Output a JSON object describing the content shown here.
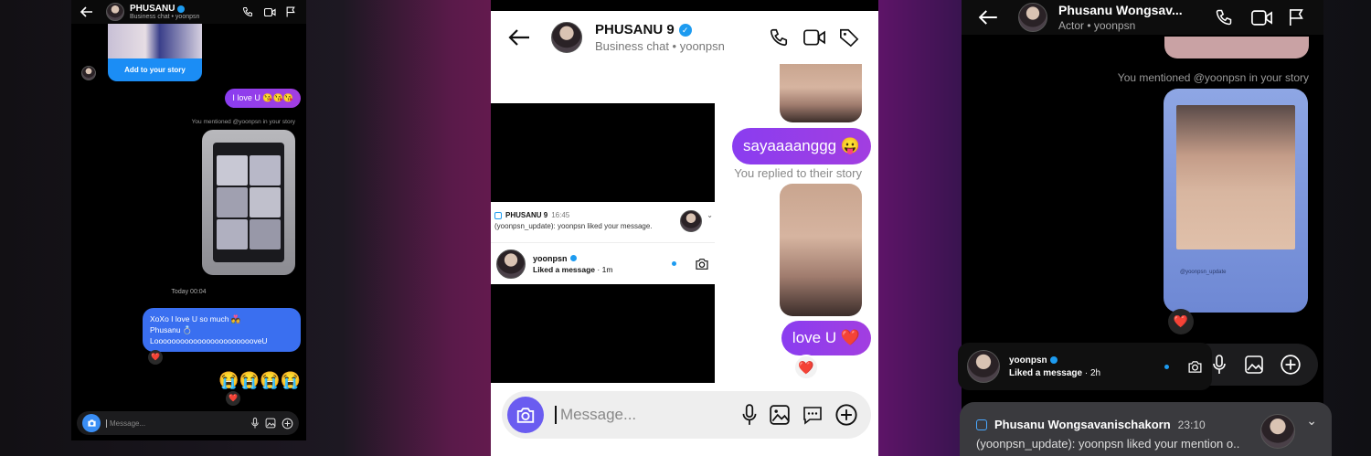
{
  "left": {
    "contact_name": "PHUSANU",
    "contact_sub": "Business chat • yoonpsn",
    "add_story": "Add to your story",
    "msg_love": "I love U 😘😘😘",
    "mention_note": "You mentioned @yoonpsn in your story",
    "time_divider": "Today 00:04",
    "long_msg": "XoXo I love U so much 💑\nPhusanu 💍\nLoooooooooooooooooooooooveU",
    "emoji_msg": "😭😭😭😭",
    "reaction": "❤️",
    "message_placeholder": "Message..."
  },
  "mid": {
    "contact_name": "PHUSANU 9",
    "contact_sub": "Business chat • yoonpsn",
    "msg_saya": "sayaaaanggg 😛",
    "replied_note": "You replied to their story",
    "msg_love": "love U ❤️",
    "reaction": "❤️",
    "notif_app": "PHUSANU 9",
    "notif_time": "16:45",
    "notif_text": "(yoonpsn_update): yoonpsn liked your message.",
    "activity_user": "yoonpsn",
    "activity_text": "Liked a message",
    "activity_time": "1m",
    "message_placeholder": "Message..."
  },
  "right": {
    "contact_name": "Phusanu Wongsav...",
    "contact_sub": "Actor • yoonpsn",
    "mention_note": "You mentioned @yoonpsn in your story",
    "story_caption": "@yoonpsn_update",
    "reaction": "❤️",
    "activity_user": "yoonpsn",
    "activity_text": "Liked a message",
    "activity_time": "2h",
    "notif_app": "Phusanu Wongsavanischakorn",
    "notif_time": "23:10",
    "notif_text": "(yoonpsn_update): yoonpsn liked your mention o.."
  },
  "colors": {
    "accent_purple": "#8a3df0",
    "accent_blue": "#3a6ff0",
    "verified": "#1d9bf0",
    "camera_button": "#6a5cf0"
  }
}
